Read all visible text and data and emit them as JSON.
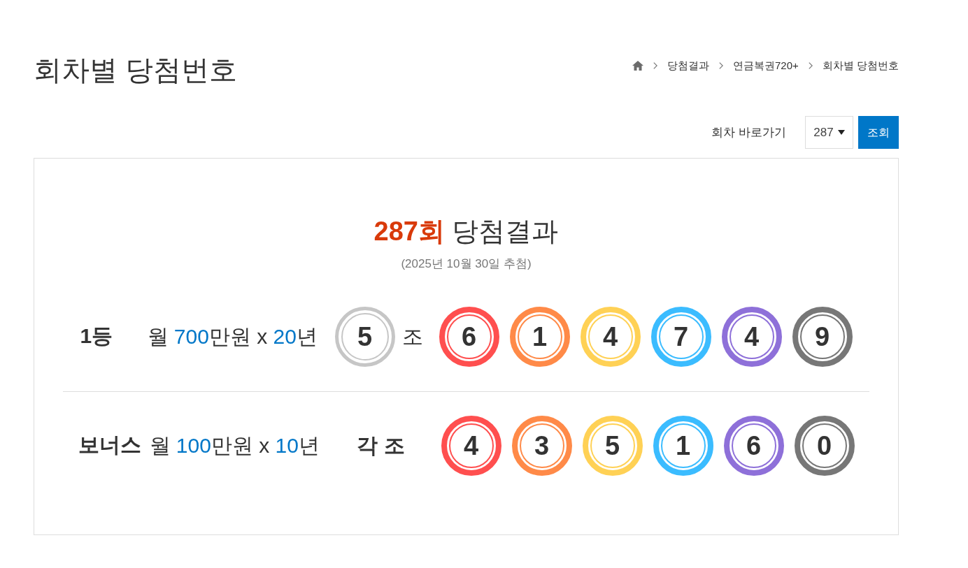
{
  "page_title": "회차별 당첨번호",
  "breadcrumb": [
    "당첨결과",
    "연금복권720+",
    "회차별 당첨번호"
  ],
  "round_jump": {
    "label": "회차 바로가기",
    "value": "287",
    "button": "조회"
  },
  "result": {
    "round": "287회",
    "title": "당첨결과",
    "date": "(2025년 10월 30일 추첨)",
    "prizes": [
      {
        "rank": "1등",
        "prize": [
          {
            "kind": "text",
            "text": "월 "
          },
          {
            "kind": "number",
            "text": "700"
          },
          {
            "kind": "text",
            "text": "만원 x "
          },
          {
            "kind": "number",
            "text": "20"
          },
          {
            "kind": "text",
            "text": "년"
          }
        ],
        "group": {
          "kind": "ball",
          "digit": "5",
          "color": "#c6c6c6",
          "unit": "조"
        },
        "numbers": [
          {
            "digit": "6",
            "color": "#ff4f4f"
          },
          {
            "digit": "1",
            "color": "#ff8a48"
          },
          {
            "digit": "4",
            "color": "#ffd155"
          },
          {
            "digit": "7",
            "color": "#3bbcff"
          },
          {
            "digit": "4",
            "color": "#8e70d9"
          },
          {
            "digit": "9",
            "color": "#777777"
          }
        ]
      },
      {
        "rank": "보너스",
        "prize": [
          {
            "kind": "text",
            "text": "월 "
          },
          {
            "kind": "number",
            "text": "100"
          },
          {
            "kind": "text",
            "text": "만원 x "
          },
          {
            "kind": "number",
            "text": "10"
          },
          {
            "kind": "text",
            "text": "년"
          }
        ],
        "group": {
          "kind": "label",
          "text": "각 조"
        },
        "numbers": [
          {
            "digit": "4",
            "color": "#ff4f4f"
          },
          {
            "digit": "3",
            "color": "#ff8a48"
          },
          {
            "digit": "5",
            "color": "#ffd155"
          },
          {
            "digit": "1",
            "color": "#3bbcff"
          },
          {
            "digit": "6",
            "color": "#8e70d9"
          },
          {
            "digit": "0",
            "color": "#777777"
          }
        ]
      }
    ]
  }
}
